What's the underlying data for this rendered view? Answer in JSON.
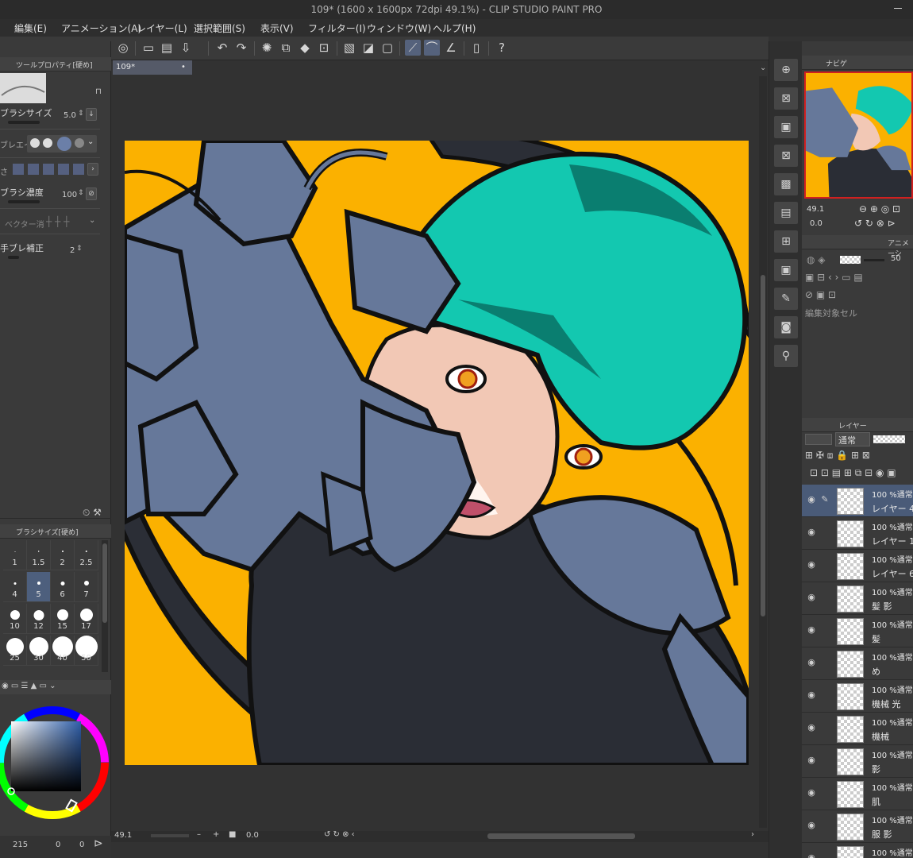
{
  "window": {
    "title": "109* (1600 x 1600px 72dpi 49.1%)  - CLIP STUDIO PAINT PRO"
  },
  "menu": [
    "編集(E)",
    "アニメーション(A)",
    "レイヤー(L)",
    "選択範囲(S)",
    "表示(V)",
    "フィルター(I)",
    "ウィンドウ(W)",
    "ヘルプ(H)"
  ],
  "tool_property": {
    "header": "ツールプロパティ[硬め]",
    "brush_size_label": "ブラシサイズ",
    "brush_size_value": "5.0",
    "brush_shape_label": "ブレエイ",
    "thickness_label": "さ",
    "density_label": "ブラシ濃度",
    "density_value": "100",
    "vector_label": "ベクター消",
    "stabilization_label": "手ブレ補正",
    "stabilization_value": "2"
  },
  "brush_size_panel": {
    "header": "ブラシサイズ[硬め]",
    "sizes": [
      "1",
      "1.5",
      "2",
      "2.5",
      "4",
      "5",
      "6",
      "7",
      "10",
      "12",
      "15",
      "17",
      "25",
      "30",
      "40",
      "50"
    ],
    "selected": "5"
  },
  "color": {
    "main": "#2f5ea8",
    "hue_marker": "#5aa0e0"
  },
  "left_bottom": {
    "value_a": "215",
    "value_b": "0",
    "value_c": "0"
  },
  "document_tab": "109*",
  "status": {
    "zoom": "49.1",
    "rotate": "0.0"
  },
  "navigator": {
    "header": "ナビゲ",
    "zoom": "49.1",
    "rotate": "0.0"
  },
  "animation": {
    "header": "アニメーシ",
    "opacity": "50",
    "target_cel_label": "編集対象セル"
  },
  "layer_panel": {
    "header": "レイヤー",
    "blend_mode": "通常",
    "layers": [
      {
        "pct": "100 %通常",
        "name": "レイヤー 4",
        "selected": true
      },
      {
        "pct": "100 %通常",
        "name": "レイヤー 1",
        "selected": false
      },
      {
        "pct": "100 %通常",
        "name": "レイヤー 6",
        "selected": false
      },
      {
        "pct": "100 %通常",
        "name": "髪 影",
        "selected": false
      },
      {
        "pct": "100 %通常",
        "name": "髪",
        "selected": false
      },
      {
        "pct": "100 %通常",
        "name": "め",
        "selected": false
      },
      {
        "pct": "100 %通常",
        "name": "機械 光",
        "selected": false
      },
      {
        "pct": "100 %通常",
        "name": "機械",
        "selected": false
      },
      {
        "pct": "100 %通常",
        "name": "影",
        "selected": false
      },
      {
        "pct": "100 %通常",
        "name": "肌",
        "selected": false
      },
      {
        "pct": "100 %通常",
        "name": "服 影",
        "selected": false
      },
      {
        "pct": "100 %通常",
        "name": "",
        "selected": false
      }
    ]
  },
  "artwork_colors": {
    "background": "#fbb100",
    "hair": "#13c8b0",
    "mech": "#66789a",
    "skin": "#f2c8b5",
    "suit": "#2a2d35"
  }
}
